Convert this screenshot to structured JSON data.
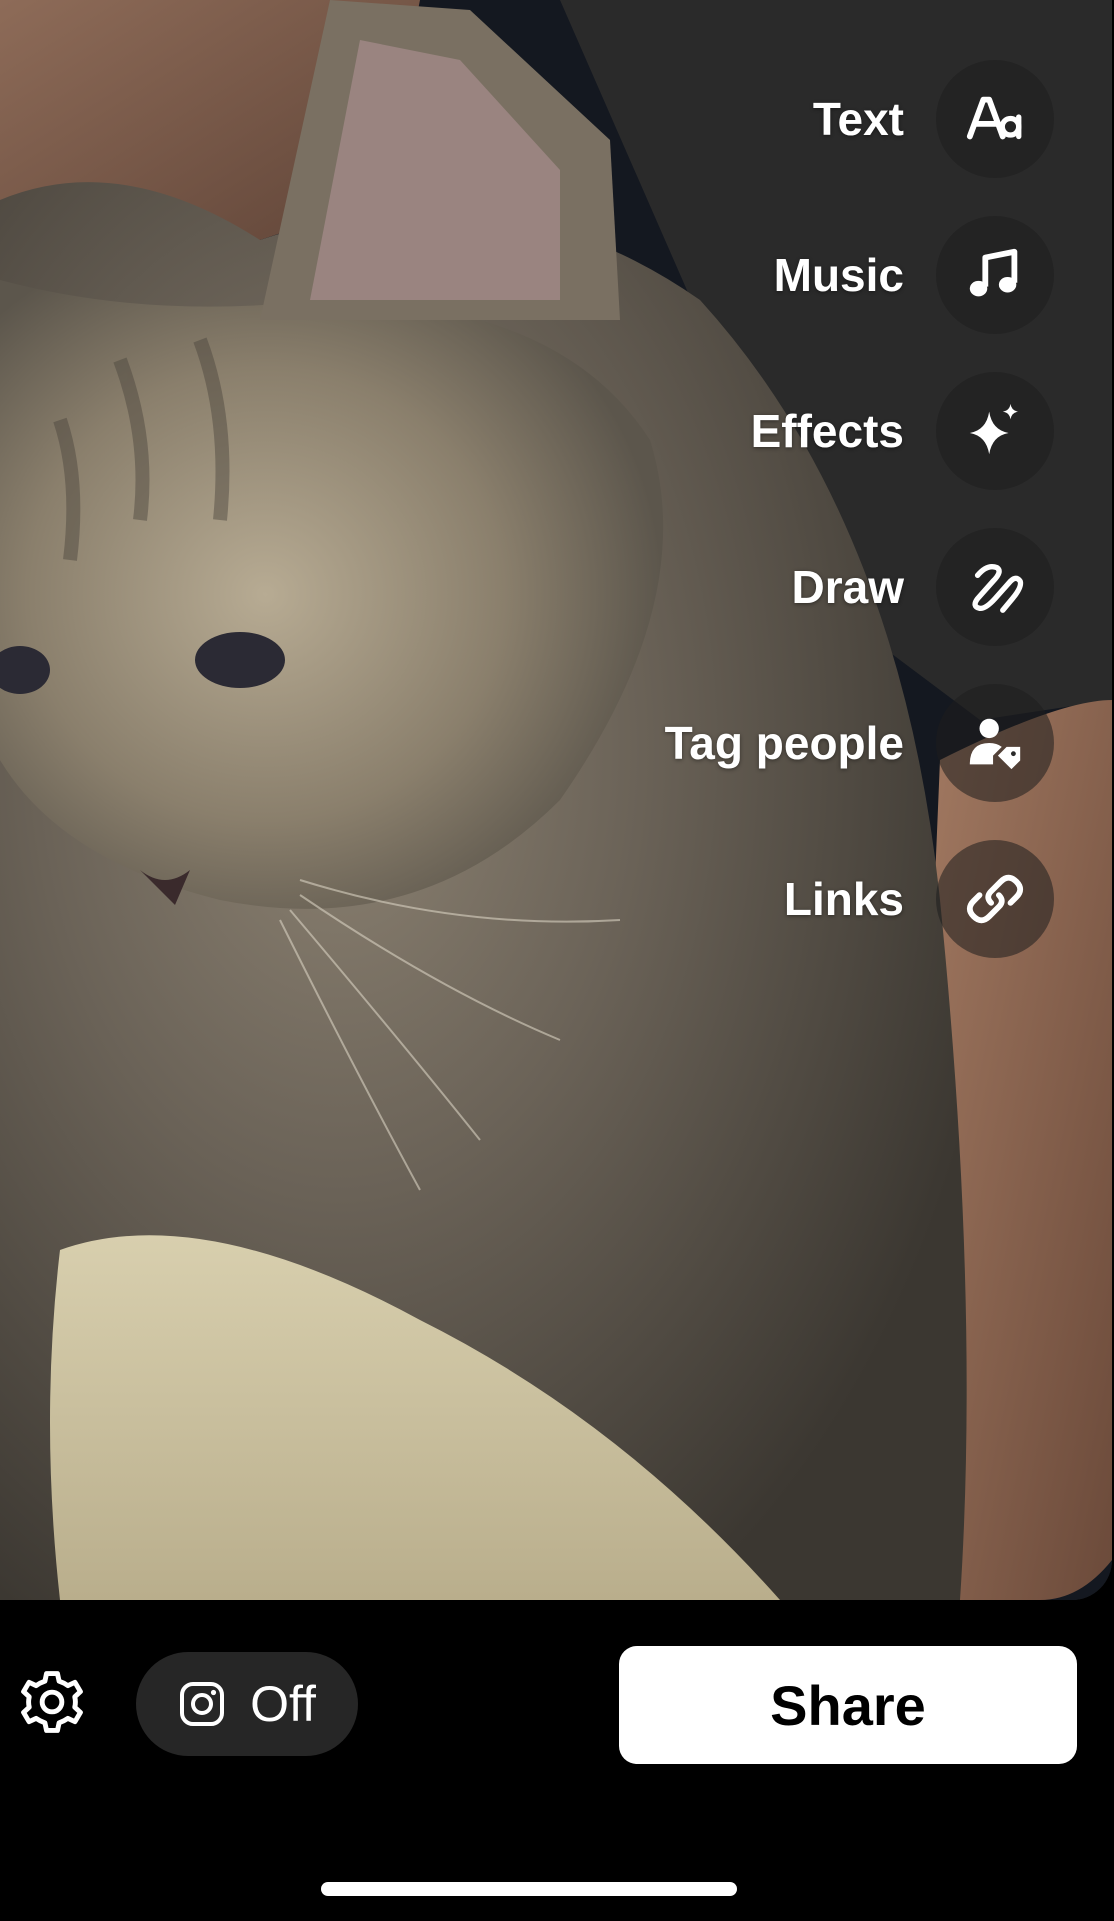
{
  "editor_tools": {
    "text": {
      "label": "Text",
      "icon": "text-aa-icon"
    },
    "music": {
      "label": "Music",
      "icon": "music-note-icon"
    },
    "effects": {
      "label": "Effects",
      "icon": "sparkle-icon"
    },
    "draw": {
      "label": "Draw",
      "icon": "squiggle-draw-icon"
    },
    "tag_people": {
      "label": "Tag people",
      "icon": "person-tag-icon"
    },
    "links": {
      "label": "Links",
      "icon": "link-icon"
    }
  },
  "bottom_bar": {
    "settings_icon": "gear-icon",
    "instagram_toggle": {
      "icon": "instagram-icon",
      "label": "Off"
    },
    "share_label": "Share"
  },
  "colors": {
    "background": "#000000",
    "tool_button_bg": "#1e1e1e",
    "toggle_bg": "#262626",
    "share_bg": "#ffffff",
    "share_text": "#000000"
  }
}
